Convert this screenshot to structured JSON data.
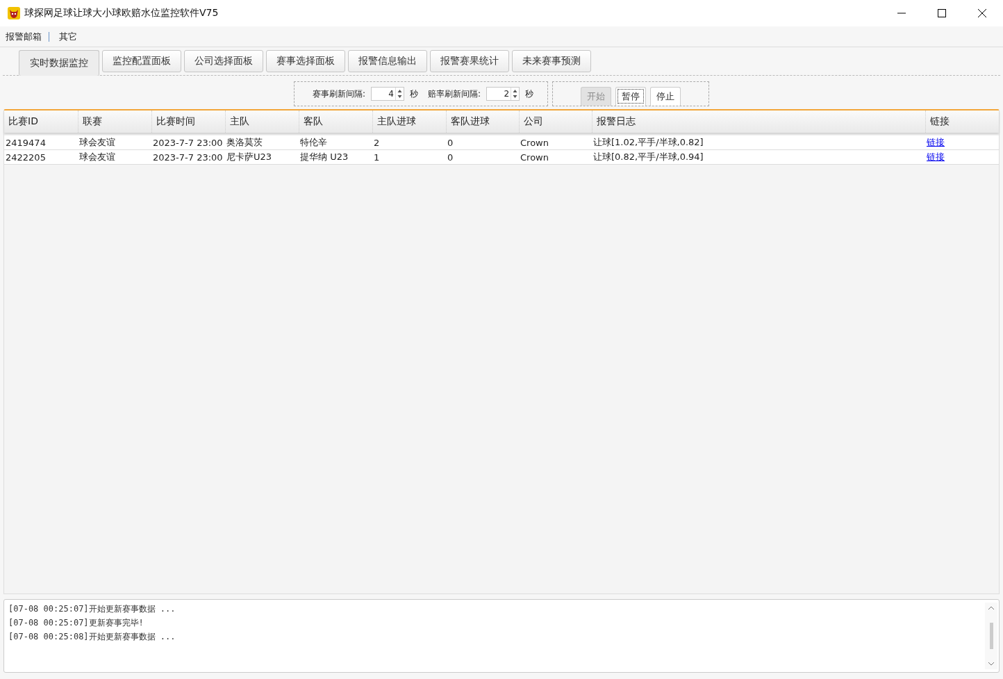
{
  "window": {
    "title": "球探网足球让球大小球欧赔水位监控软件V75"
  },
  "menu": [
    "报警邮箱",
    "其它"
  ],
  "tabs": [
    {
      "label": "实时数据监控",
      "selected": true
    },
    {
      "label": "监控配置面板",
      "selected": false
    },
    {
      "label": "公司选择面板",
      "selected": false
    },
    {
      "label": "赛事选择面板",
      "selected": false
    },
    {
      "label": "报警信息输出",
      "selected": false
    },
    {
      "label": "报警赛果统计",
      "selected": false
    },
    {
      "label": "未来赛事预测",
      "selected": false
    }
  ],
  "intervals": [
    {
      "label": "赛事刷新间隔:",
      "value": "4",
      "unit": "秒"
    },
    {
      "label": "赔率刷新间隔:",
      "value": "2",
      "unit": "秒"
    }
  ],
  "buttons": [
    {
      "label": "开始",
      "disabled": true,
      "focused": false
    },
    {
      "label": "暂停",
      "disabled": false,
      "focused": true
    },
    {
      "label": "停止",
      "disabled": false,
      "focused": false
    }
  ],
  "table": {
    "columns": [
      "比赛ID",
      "联赛",
      "比赛时间",
      "主队",
      "客队",
      "主队进球",
      "客队进球",
      "公司",
      "报警日志",
      "链接"
    ],
    "rows": [
      [
        "2419474",
        "球会友谊",
        "2023-7-7 23:00",
        "奥洛莫茨",
        "特伦辛",
        "2",
        "0",
        "Crown",
        "让球[1.02,平手/半球,0.82]",
        "链接"
      ],
      [
        "2422205",
        "球会友谊",
        "2023-7-7 23:00",
        "尼卡萨U23",
        "提华纳 U23",
        "1",
        "0",
        "Crown",
        "让球[0.82,平手/半球,0.94]",
        "链接"
      ]
    ]
  },
  "log": [
    "[07-08 00:25:07]开始更新赛事数据 ...",
    "[07-08 00:25:07]更新赛事完毕!",
    "[07-08 00:25:08]开始更新赛事数据 ..."
  ]
}
